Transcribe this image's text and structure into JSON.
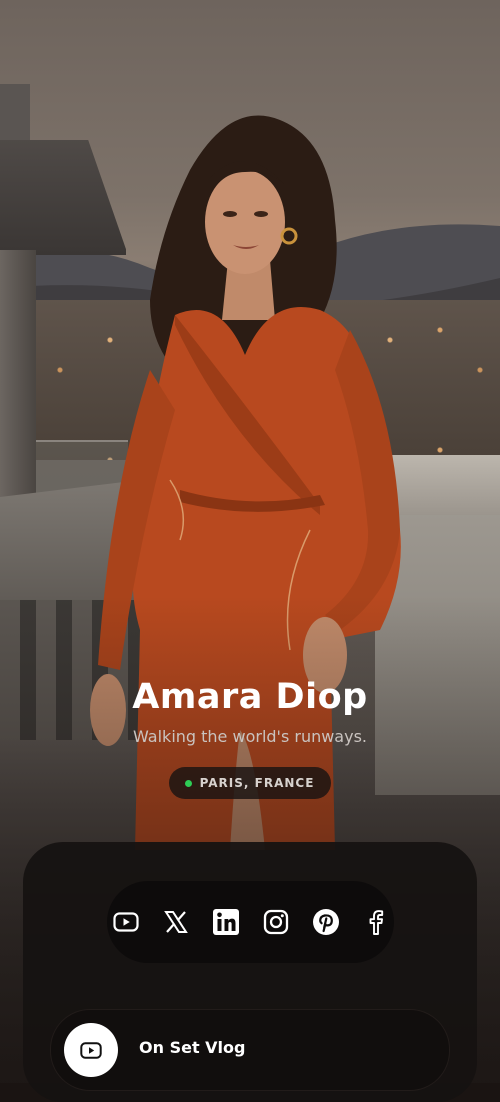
{
  "profile": {
    "name": "Amara Diop",
    "tagline": "Walking the world's runways.",
    "location": "PARIS, FRANCE"
  },
  "socials": [
    {
      "icon": "youtube-icon"
    },
    {
      "icon": "x-icon"
    },
    {
      "icon": "linkedin-icon"
    },
    {
      "icon": "instagram-icon"
    },
    {
      "icon": "pinterest-icon"
    },
    {
      "icon": "facebook-icon"
    }
  ],
  "links": [
    {
      "label": "On Set Vlog",
      "icon": "youtube-icon"
    }
  ],
  "colors": {
    "status_dot": "#2ecc55",
    "dress": "#b8491f",
    "card": "#161211",
    "text": "#ffffff"
  }
}
